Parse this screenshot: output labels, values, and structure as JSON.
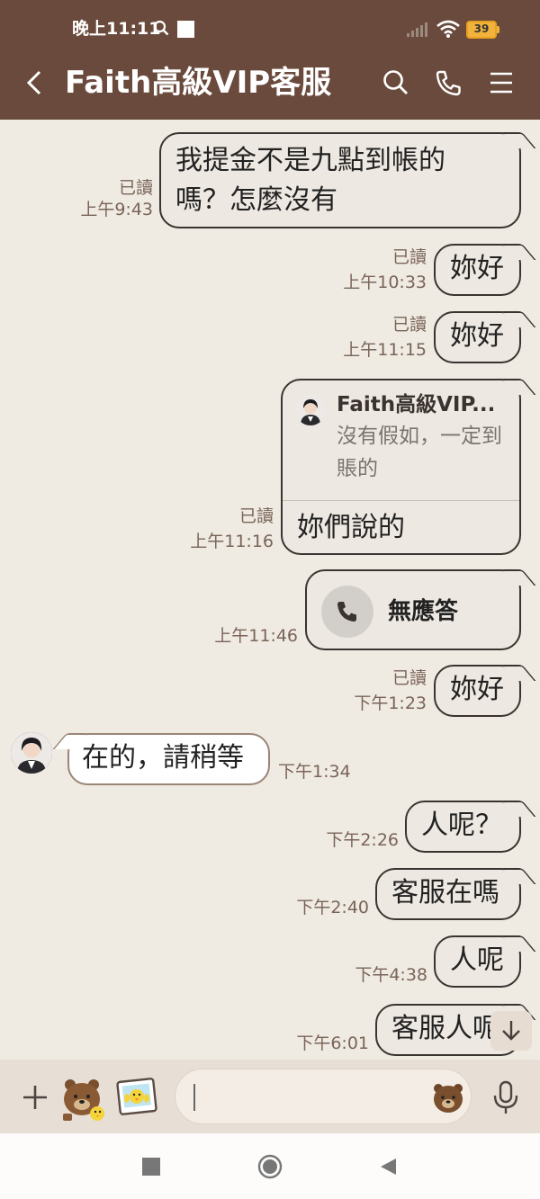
{
  "status_bar": {
    "time": "晚上11:11",
    "battery": "39"
  },
  "header": {
    "title": "Faith高級VIP客服"
  },
  "messages": [
    {
      "text_line1": "我提金不是九點到帳的",
      "text_line2": "嗎？怎麼沒有",
      "read": "已讀",
      "time": "上午9:43"
    },
    {
      "text": "妳好",
      "read": "已讀",
      "time": "上午10:33"
    },
    {
      "text": "妳好",
      "read": "已讀",
      "time": "上午11:15"
    },
    {
      "quote_name": "Faith高級VIP...",
      "quote_text": "沒有假如，一定到賬的",
      "text": "妳們說的",
      "read": "已讀",
      "time": "上午11:16"
    },
    {
      "call_label": "無應答",
      "time": "上午11:46"
    },
    {
      "text": "妳好",
      "read": "已讀",
      "time": "下午1:23"
    },
    {
      "text": "在的，請稍等",
      "time": "下午1:34"
    },
    {
      "text": "人呢？",
      "time": "下午2:26"
    },
    {
      "text": "客服在嗎",
      "time": "下午2:40"
    },
    {
      "text": "人呢",
      "time": "下午4:38"
    },
    {
      "text": "客服人呢",
      "time": "下午6:01"
    }
  ],
  "input": {
    "value": ""
  },
  "colors": {
    "header_bg": "#6a4a3c",
    "chat_bg": "#efebe3",
    "outgoing_bubble": "#ede8e1",
    "incoming_bubble": "#ffffff",
    "meta_text": "#7a6458"
  },
  "icons": [
    "back-arrow-icon",
    "search-icon",
    "phone-icon",
    "menu-icon",
    "plus-icon",
    "sticker-icon",
    "photo-icon",
    "emoji-icon",
    "mic-icon",
    "scroll-down-icon"
  ]
}
